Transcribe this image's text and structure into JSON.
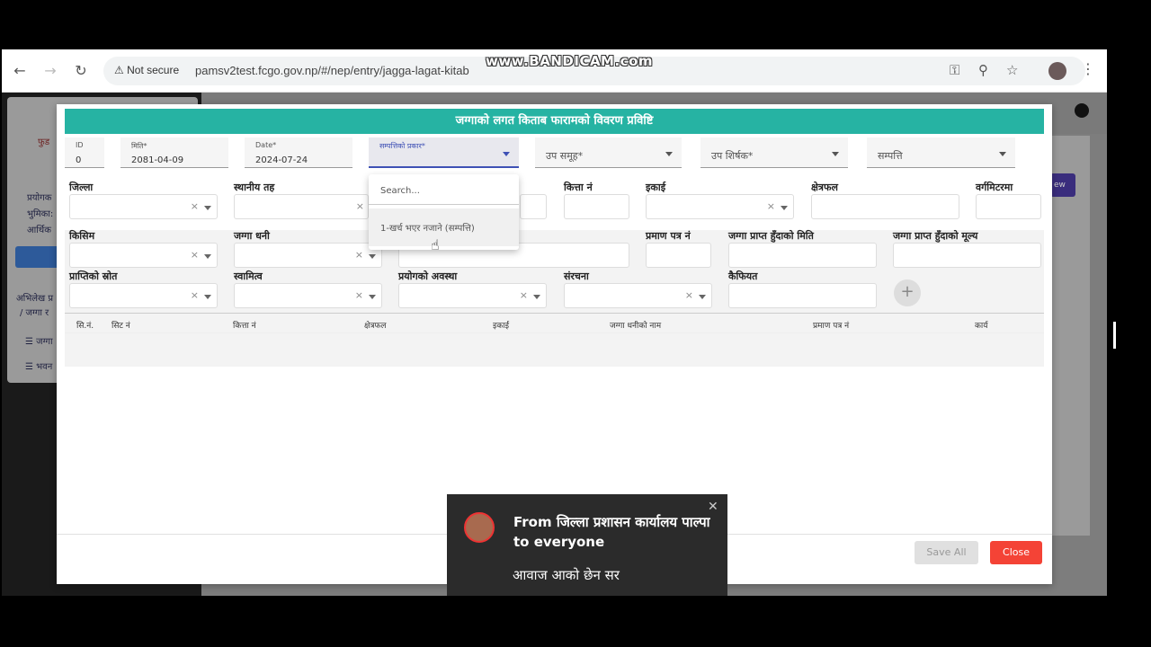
{
  "browser": {
    "security_label": "Not secure",
    "url": "pamsv2test.fcgo.gov.np/#/nep/entry/jagga-lagat-kitab",
    "watermark": "www.BANDICAM.com",
    "icons": [
      "back-icon",
      "forward-icon",
      "reload-icon",
      "warning-icon",
      "key-icon",
      "zoom-icon",
      "star-icon",
      "kebab-icon"
    ]
  },
  "background": {
    "left_text_1": "फुड",
    "left_text_2": "प्रयोगक",
    "left_text_3": "भुमिका:",
    "left_text_4": "आर्थिक",
    "left_text_5": "अभिलेख प्र",
    "left_text_6": "/ जग्गा र",
    "left_text_7": "जग्गा",
    "left_text_8": "भवन",
    "new_button": "ew"
  },
  "modal": {
    "title": "जग्गाको लगत किताब फारामको विवरण प्रविष्टि",
    "top_fields": {
      "id_label": "ID",
      "id_value": "0",
      "miti_label": "मिति",
      "miti_value": "2081-04-09",
      "date_label": "Date",
      "date_value": "2024-07-24",
      "sampatti_prakar_label": "सम्पत्तिको प्रकार",
      "upa_samuha_label": "उप समूह",
      "upa_shirshak_label": "उप शिर्षक",
      "sampatti_label": "सम्पत्ति"
    },
    "row1": {
      "jilla": "जिल्ला",
      "sthaniya_taha": "स्थानीय तह",
      "kitta_no": "कित्ता नं",
      "ekai": "इकाई",
      "kshetrafal": "क्षेत्रफल",
      "vargamitarma": "वर्गमिटरमा"
    },
    "row2": {
      "kisim": "किसिम",
      "jagga_dhani": "जग्गा धनी",
      "praman_patra_no": "प्रमाण पत्र नं",
      "jagga_prapta_miti": "जग्गा प्राप्त हुँदाको मिति",
      "jagga_prapta_mulya": "जग्गा प्राप्त हुँदाको मूल्य"
    },
    "row3": {
      "prapti_srot": "प्राप्तिको स्रोत",
      "swamitwa": "स्वामित्व",
      "prayog_awastha": "प्रयोगको अवस्था",
      "sanrachana": "संरचना",
      "kaifiyat": "कैफियत"
    },
    "table_headers": [
      "सि.नं.",
      "सिट नं",
      "कित्ता नं",
      "क्षेत्रफल",
      "इकाई",
      "जग्गा धनीको नाम",
      "प्रमाण पत्र नं",
      "कार्य"
    ],
    "buttons": {
      "save_all": "Save All",
      "close": "Close"
    }
  },
  "dropdown": {
    "search_placeholder": "Search...",
    "option_1": "1-खर्च भएर नजाने (सम्पत्ति)"
  },
  "toast": {
    "from": "From जिल्ला प्रशासन कार्यालय पाल्पा to everyone",
    "message": "आवाज आको छेन सर"
  }
}
